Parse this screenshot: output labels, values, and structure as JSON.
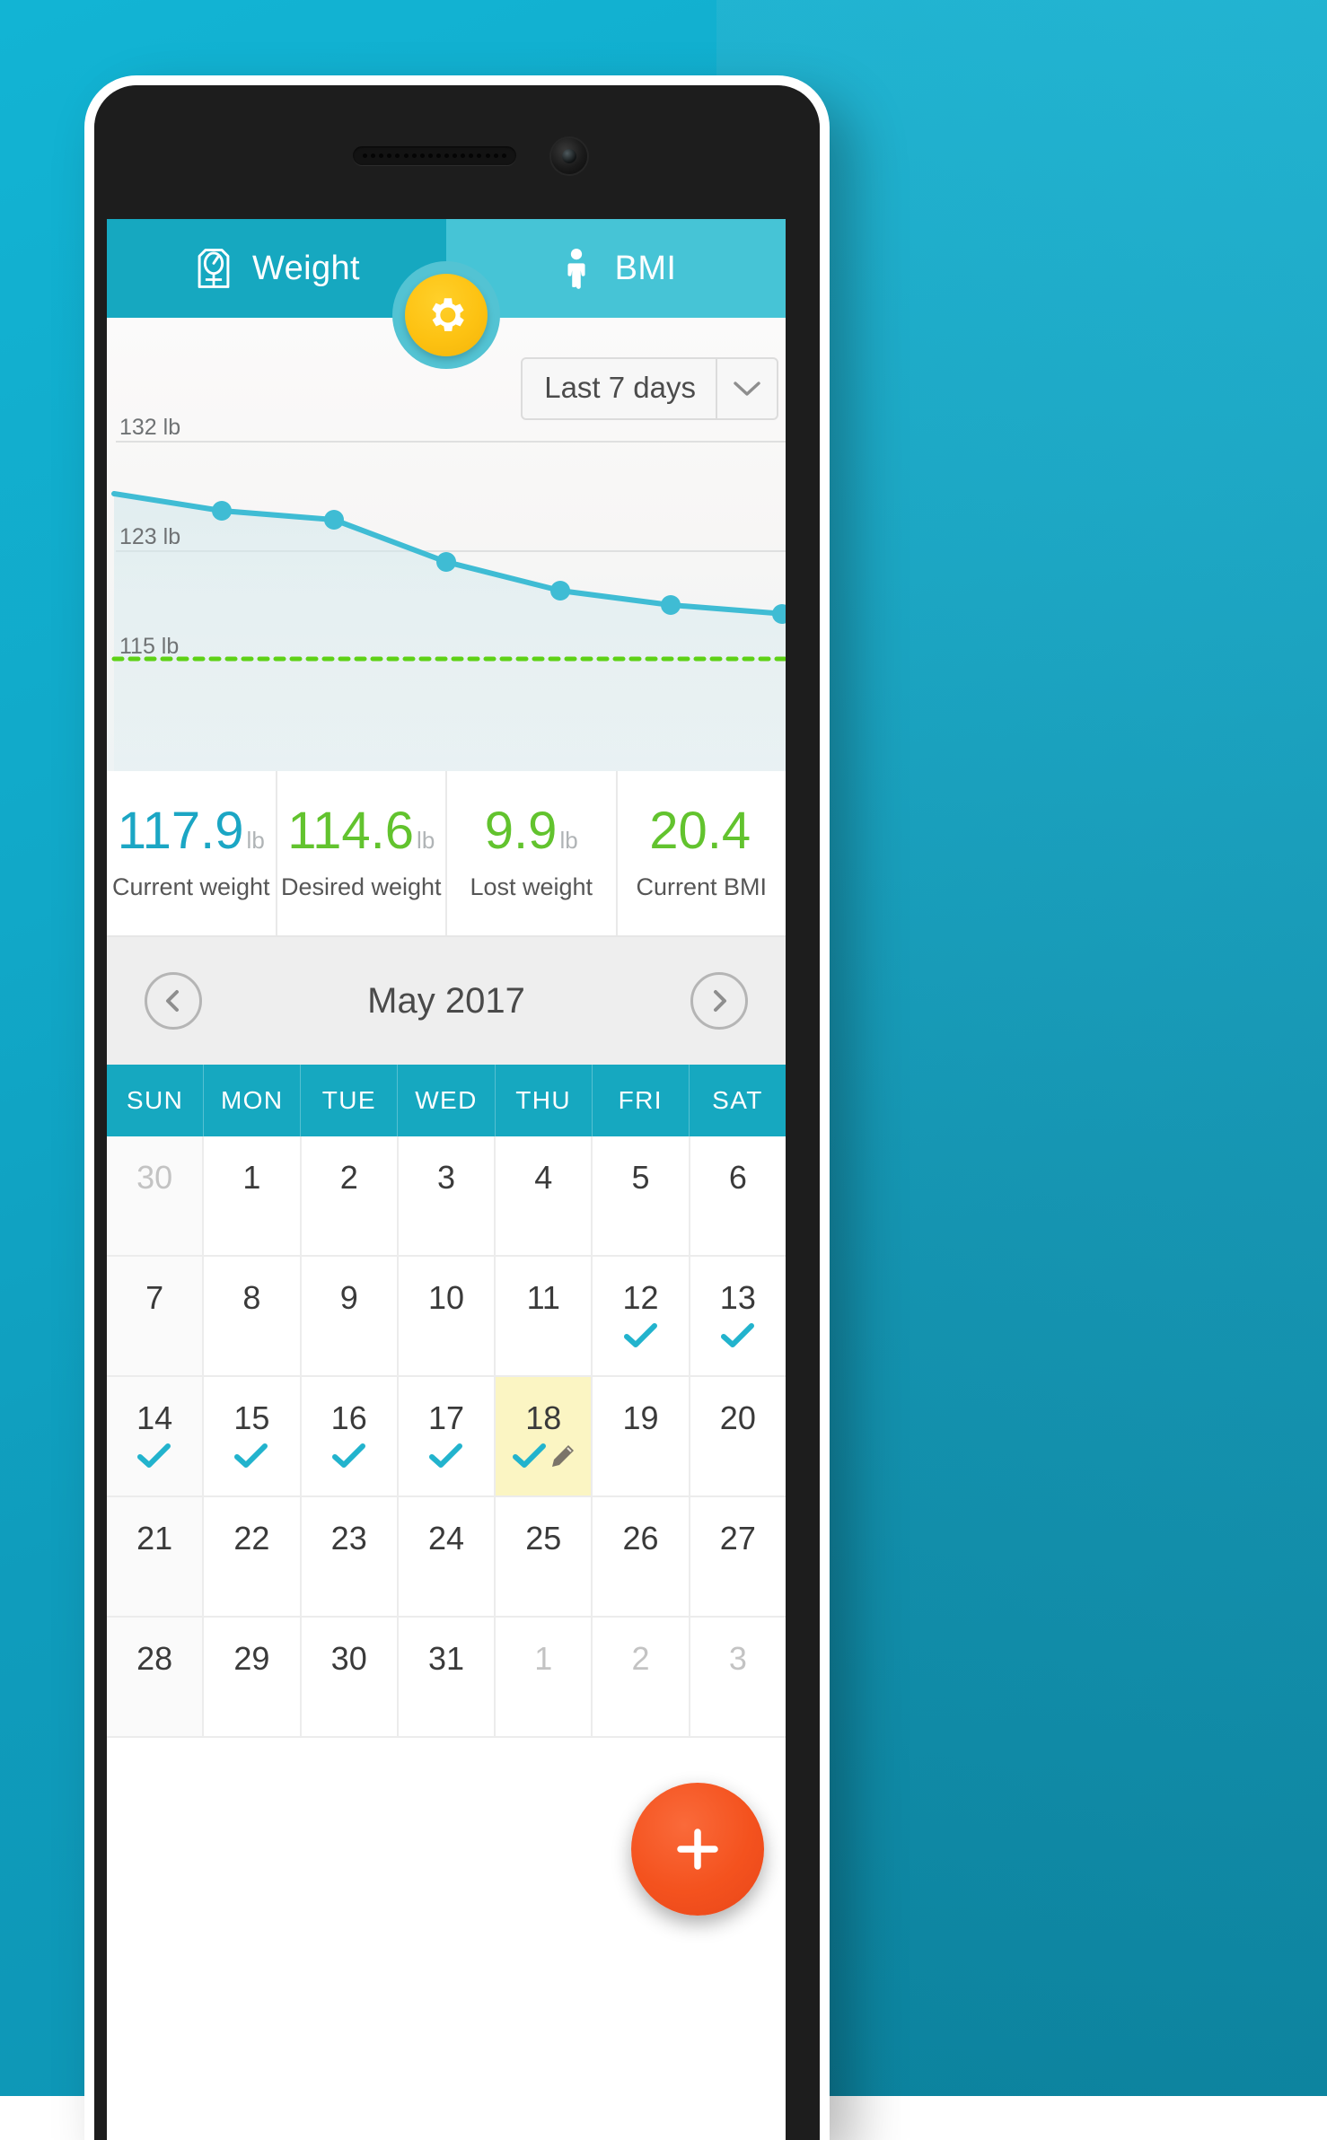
{
  "app": {
    "tabs": [
      {
        "label": "Weight",
        "icon": "scale-icon",
        "active": true
      },
      {
        "label": "BMI",
        "icon": "person-icon",
        "active": false
      }
    ],
    "settings_button": {
      "icon": "gear-icon",
      "label": "Settings"
    },
    "add_button": {
      "icon": "plus-icon",
      "label": "Add entry"
    }
  },
  "colors": {
    "teal": "#16a8c0",
    "teal_light": "#46c4d6",
    "teal_line": "#3fbcd4",
    "green": "#62c32e",
    "yellow": "#fdc212",
    "orange": "#f4521e",
    "today_bg": "#fbf5c3"
  },
  "range_selector": {
    "value": "Last 7 days",
    "caret_icon": "chevron-down-icon"
  },
  "chart_data": {
    "type": "line",
    "title": "",
    "xlabel": "",
    "ylabel": "",
    "unit": "lb",
    "ylim": [
      111,
      136
    ],
    "ytick_labels": [
      "132 lb",
      "123 lb",
      "115 lb"
    ],
    "ytick_values": [
      132,
      123,
      115
    ],
    "grid": true,
    "legend": "none",
    "series": [
      {
        "name": "Weight",
        "color": "#3fbcd4",
        "x": [
          0,
          1,
          2,
          3,
          4,
          5,
          6,
          7
        ],
        "values": [
          127.8,
          125.3,
          124.8,
          121.6,
          119.4,
          118.6,
          117.9,
          117.9
        ]
      }
    ],
    "target_line": {
      "name": "Desired weight",
      "value": 115,
      "color": "#5ed116",
      "style": "dotted"
    }
  },
  "stats": [
    {
      "value": "117.9",
      "unit": "lb",
      "label": "Current weight",
      "color": "#1ba6c4"
    },
    {
      "value": "114.6",
      "unit": "lb",
      "label": "Desired weight",
      "color": "#62c32e"
    },
    {
      "value": "9.9",
      "unit": "lb",
      "label": "Lost weight",
      "color": "#62c32e"
    },
    {
      "value": "20.4",
      "unit": "",
      "label": "Current BMI",
      "color": "#62c32e"
    }
  ],
  "calendar": {
    "title": "May 2017",
    "prev_label": "Previous month",
    "next_label": "Next month",
    "prev_icon": "chevron-left-icon",
    "next_icon": "chevron-right-icon",
    "weekdays": [
      "SUN",
      "MON",
      "TUE",
      "WED",
      "THU",
      "FRI",
      "SAT"
    ],
    "weeks": [
      [
        {
          "day": "30",
          "muted": true,
          "check": false,
          "edit": false,
          "today": false
        },
        {
          "day": "1",
          "muted": false,
          "check": false,
          "edit": false,
          "today": false
        },
        {
          "day": "2",
          "muted": false,
          "check": false,
          "edit": false,
          "today": false
        },
        {
          "day": "3",
          "muted": false,
          "check": false,
          "edit": false,
          "today": false
        },
        {
          "day": "4",
          "muted": false,
          "check": false,
          "edit": false,
          "today": false
        },
        {
          "day": "5",
          "muted": false,
          "check": false,
          "edit": false,
          "today": false
        },
        {
          "day": "6",
          "muted": false,
          "check": false,
          "edit": false,
          "today": false
        }
      ],
      [
        {
          "day": "7",
          "muted": false,
          "check": false,
          "edit": false,
          "today": false
        },
        {
          "day": "8",
          "muted": false,
          "check": false,
          "edit": false,
          "today": false
        },
        {
          "day": "9",
          "muted": false,
          "check": false,
          "edit": false,
          "today": false
        },
        {
          "day": "10",
          "muted": false,
          "check": false,
          "edit": false,
          "today": false
        },
        {
          "day": "11",
          "muted": false,
          "check": false,
          "edit": false,
          "today": false
        },
        {
          "day": "12",
          "muted": false,
          "check": true,
          "edit": false,
          "today": false
        },
        {
          "day": "13",
          "muted": false,
          "check": true,
          "edit": false,
          "today": false
        }
      ],
      [
        {
          "day": "14",
          "muted": false,
          "check": true,
          "edit": false,
          "today": false
        },
        {
          "day": "15",
          "muted": false,
          "check": true,
          "edit": false,
          "today": false
        },
        {
          "day": "16",
          "muted": false,
          "check": true,
          "edit": false,
          "today": false
        },
        {
          "day": "17",
          "muted": false,
          "check": true,
          "edit": false,
          "today": false
        },
        {
          "day": "18",
          "muted": false,
          "check": true,
          "edit": true,
          "today": true
        },
        {
          "day": "19",
          "muted": false,
          "check": false,
          "edit": false,
          "today": false
        },
        {
          "day": "20",
          "muted": false,
          "check": false,
          "edit": false,
          "today": false
        }
      ],
      [
        {
          "day": "21",
          "muted": false,
          "check": false,
          "edit": false,
          "today": false
        },
        {
          "day": "22",
          "muted": false,
          "check": false,
          "edit": false,
          "today": false
        },
        {
          "day": "23",
          "muted": false,
          "check": false,
          "edit": false,
          "today": false
        },
        {
          "day": "24",
          "muted": false,
          "check": false,
          "edit": false,
          "today": false
        },
        {
          "day": "25",
          "muted": false,
          "check": false,
          "edit": false,
          "today": false
        },
        {
          "day": "26",
          "muted": false,
          "check": false,
          "edit": false,
          "today": false
        },
        {
          "day": "27",
          "muted": false,
          "check": false,
          "edit": false,
          "today": false
        }
      ],
      [
        {
          "day": "28",
          "muted": false,
          "check": false,
          "edit": false,
          "today": false
        },
        {
          "day": "29",
          "muted": false,
          "check": false,
          "edit": false,
          "today": false
        },
        {
          "day": "30",
          "muted": false,
          "check": false,
          "edit": false,
          "today": false
        },
        {
          "day": "31",
          "muted": false,
          "check": false,
          "edit": false,
          "today": false
        },
        {
          "day": "1",
          "muted": true,
          "check": false,
          "edit": false,
          "today": false
        },
        {
          "day": "2",
          "muted": true,
          "check": false,
          "edit": false,
          "today": false
        },
        {
          "day": "3",
          "muted": true,
          "check": false,
          "edit": false,
          "today": false
        }
      ]
    ]
  }
}
